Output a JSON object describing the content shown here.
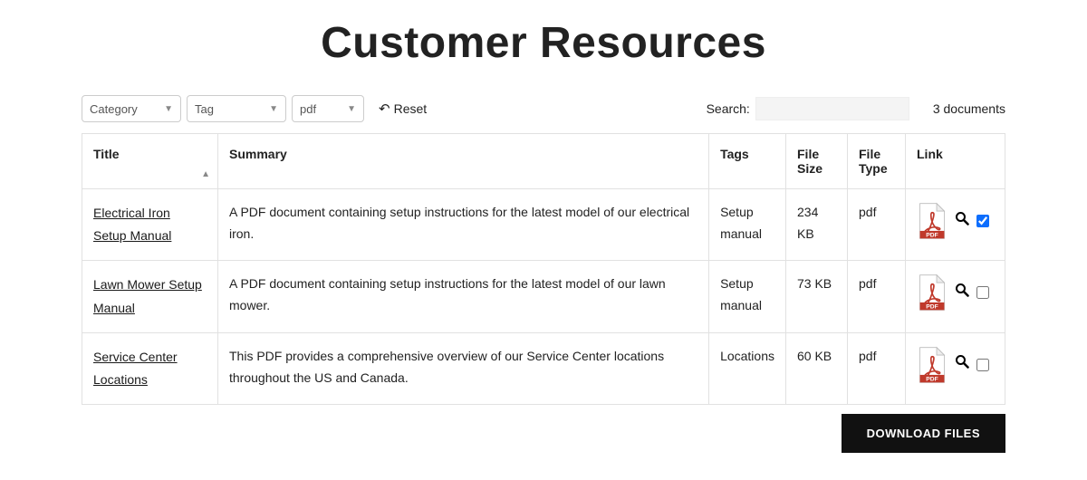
{
  "page_title": "Customer Resources",
  "filters": {
    "category_placeholder": "Category",
    "tag_placeholder": "Tag",
    "filetype_value": "pdf",
    "reset_label": "Reset"
  },
  "search": {
    "label": "Search:",
    "value": ""
  },
  "document_count_text": "3 documents",
  "columns": {
    "title": "Title",
    "summary": "Summary",
    "tags": "Tags",
    "file_size": "File Size",
    "file_type": "File Type",
    "link": "Link"
  },
  "rows": [
    {
      "title": "Electrical Iron Setup Manual",
      "summary": "A PDF document containing setup instructions for the latest model of our electrical iron.",
      "tags": "Setup manual",
      "file_size": "234 KB",
      "file_type": "pdf",
      "checked": true
    },
    {
      "title": "Lawn Mower Setup Manual",
      "summary": "A PDF document containing setup instructions for the latest model of our lawn mower.",
      "tags": "Setup manual",
      "file_size": "73 KB",
      "file_type": "pdf",
      "checked": false
    },
    {
      "title": "Service Center Locations",
      "summary": "This PDF provides a comprehensive overview of our Service Center locations throughout the US and Canada.",
      "tags": "Locations",
      "file_size": "60 KB",
      "file_type": "pdf",
      "checked": false
    }
  ],
  "download_button": "DOWNLOAD FILES",
  "icons": {
    "pdf": "pdf-icon",
    "magnify": "magnify-icon",
    "reset": "undo-icon",
    "caret": "caret-down-icon",
    "sort": "sort-arrow-icon"
  }
}
